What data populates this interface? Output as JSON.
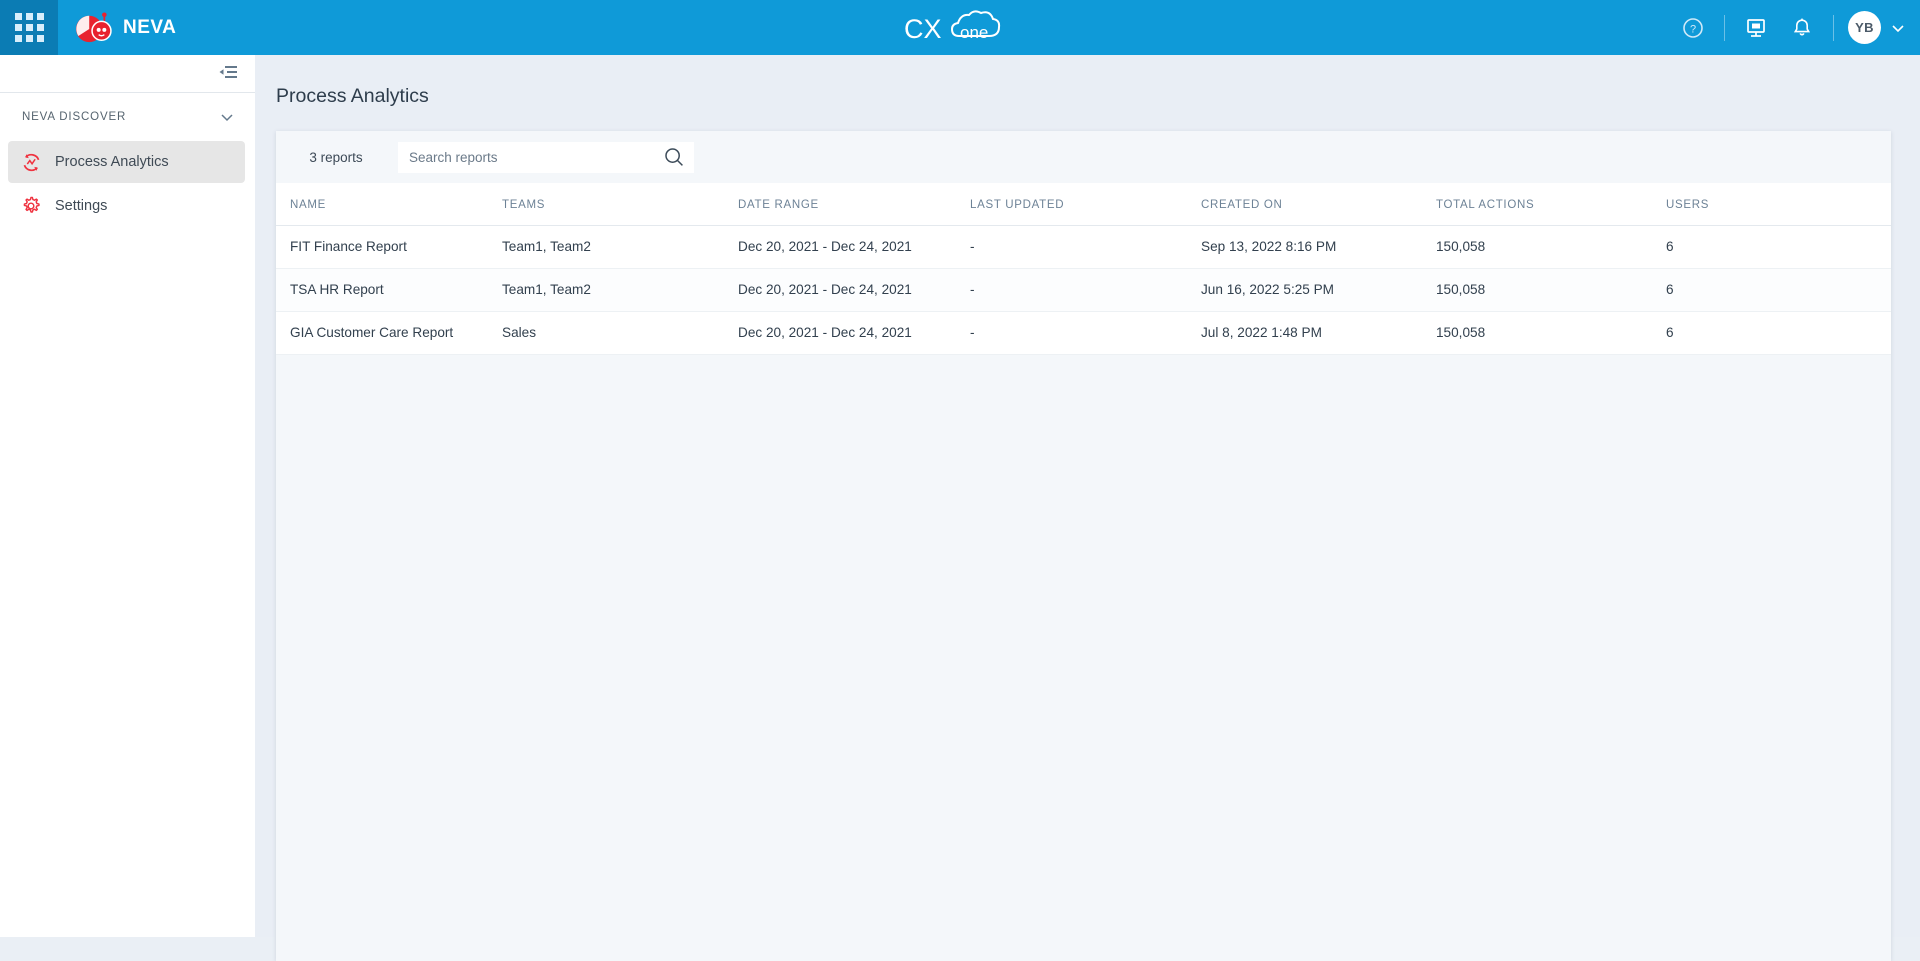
{
  "topbar": {
    "app_grid_icon": "apps-grid-icon",
    "brand_name": "NEVA",
    "brand_logo_icon": "neva-robot-logo",
    "product_logo": "CXone",
    "product_logo_text_1": "CX",
    "product_logo_text_2": "one",
    "help_icon": "help-circle-icon",
    "presentation_icon": "presentation-screen-icon",
    "notifications_icon": "bell-icon",
    "avatar_initials": "YB",
    "avatar_chevron_icon": "chevron-down-icon",
    "bar_color": "#0f9ad8",
    "app_grid_color": "#0b7cb4"
  },
  "sidebar": {
    "collapse_icon": "collapse-panel-icon",
    "section": {
      "label": "NEVA DISCOVER",
      "chevron_icon": "chevron-down-icon"
    },
    "items": [
      {
        "label": "Process Analytics",
        "icon": "process-analytics-icon",
        "active": true
      },
      {
        "label": "Settings",
        "icon": "gear-icon",
        "active": false
      }
    ],
    "accent_color": "#ef3340"
  },
  "main": {
    "page_title": "Process Analytics",
    "toolbar": {
      "report_count": "3 reports",
      "search_placeholder": "Search reports",
      "search_value": "",
      "search_icon": "search-icon"
    },
    "table": {
      "columns": [
        "NAME",
        "TEAMS",
        "DATE RANGE",
        "LAST UPDATED",
        "CREATED ON",
        "TOTAL ACTIONS",
        "USERS"
      ],
      "rows": [
        {
          "name": "FIT Finance Report",
          "teams": "Team1, Team2",
          "date_range": "Dec 20, 2021 - Dec 24, 2021",
          "last_updated": "-",
          "created_on": "Sep 13, 2022 8:16 PM",
          "total_actions": "150,058",
          "users": "6"
        },
        {
          "name": "TSA HR Report",
          "teams": "Team1, Team2",
          "date_range": "Dec 20, 2021 - Dec 24, 2021",
          "last_updated": "-",
          "created_on": "Jun 16, 2022 5:25 PM",
          "total_actions": "150,058",
          "users": "6"
        },
        {
          "name": "GIA Customer Care Report",
          "teams": "Sales",
          "date_range": "Dec 20, 2021 - Dec 24, 2021",
          "last_updated": "-",
          "created_on": "Jul 8, 2022 1:48 PM",
          "total_actions": "150,058",
          "users": "6"
        }
      ]
    }
  }
}
